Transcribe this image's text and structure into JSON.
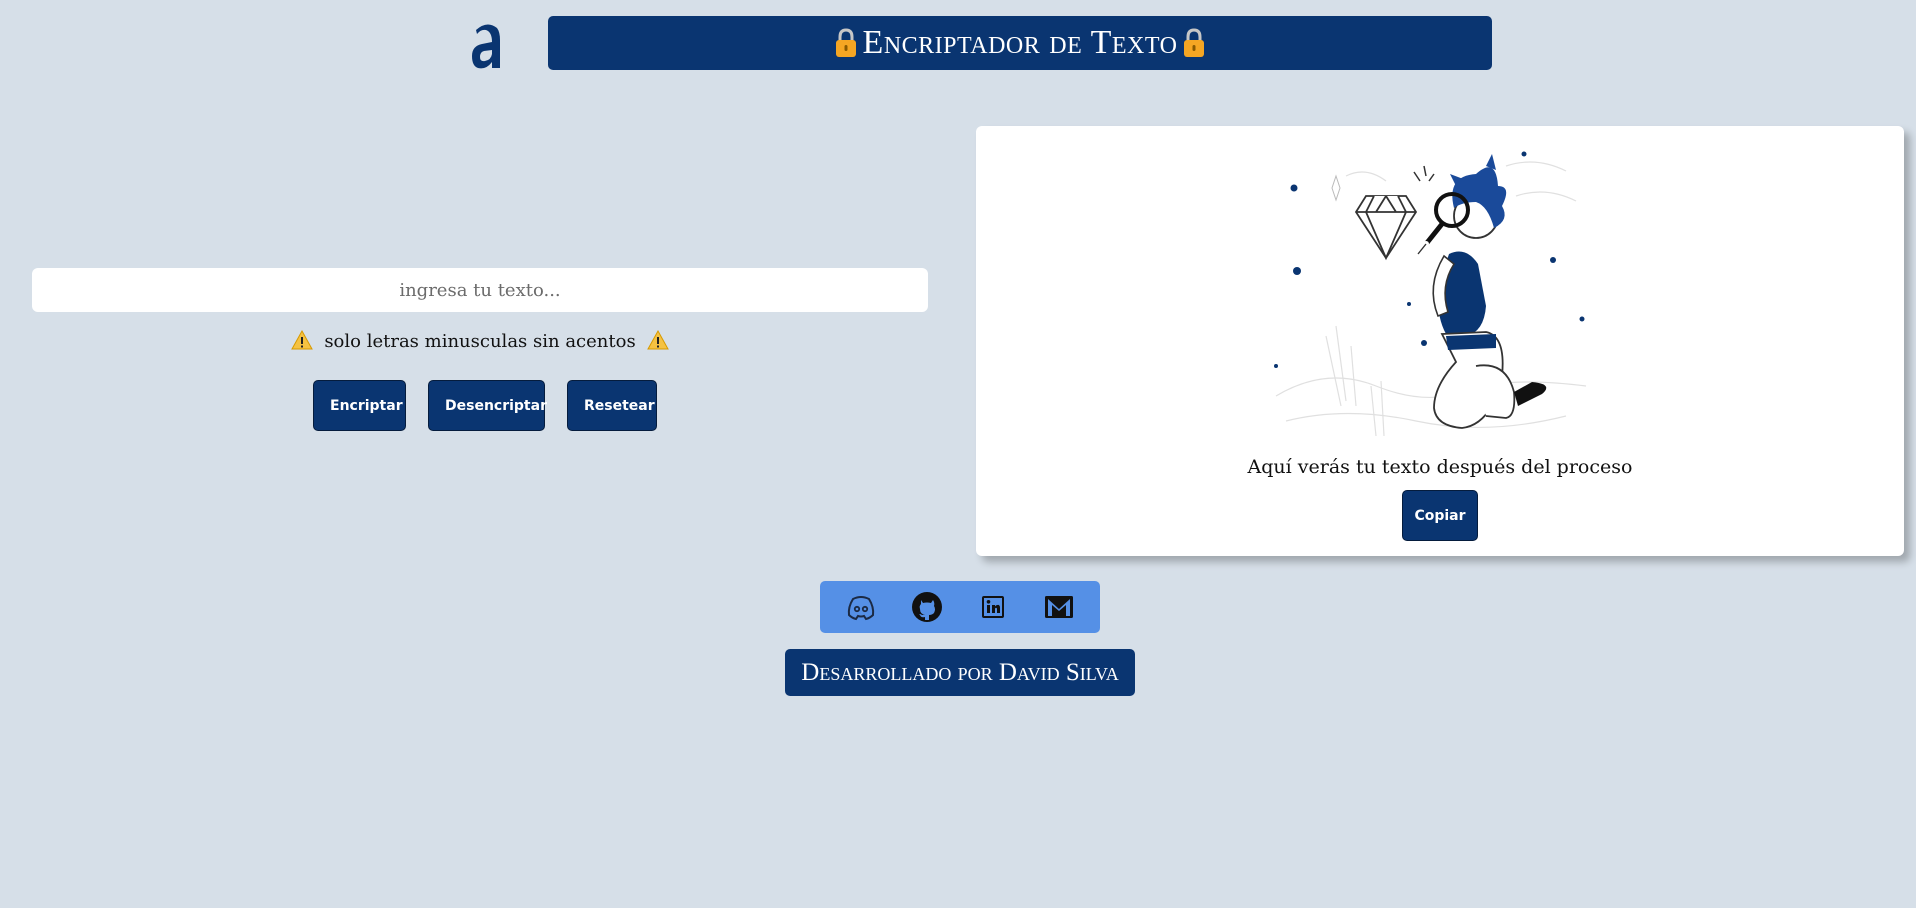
{
  "header": {
    "title": "Encriptador de Texto",
    "logo_icon": "alura-logo-icon",
    "lock_icon": "lock-icon"
  },
  "input": {
    "placeholder": "ingresa tu texto...",
    "value": ""
  },
  "warning": {
    "text": "solo letras minusculas sin acentos",
    "icon": "warning-icon"
  },
  "buttons": {
    "encrypt": "Encriptar",
    "decrypt": "Desencriptar",
    "reset": "Resetear",
    "copy": "Copiar"
  },
  "result": {
    "text": "Aquí verás tu texto después del proceso",
    "illustration": "person-with-magnifier-illustration"
  },
  "social": {
    "icons": [
      "discord-icon",
      "github-icon",
      "linkedin-icon",
      "gmail-icon"
    ]
  },
  "footer": {
    "credit": "Desarrollado por David Silva"
  },
  "colors": {
    "background": "#d6dfe8",
    "primary": "#0a3571",
    "social_bar": "#5590e6"
  }
}
